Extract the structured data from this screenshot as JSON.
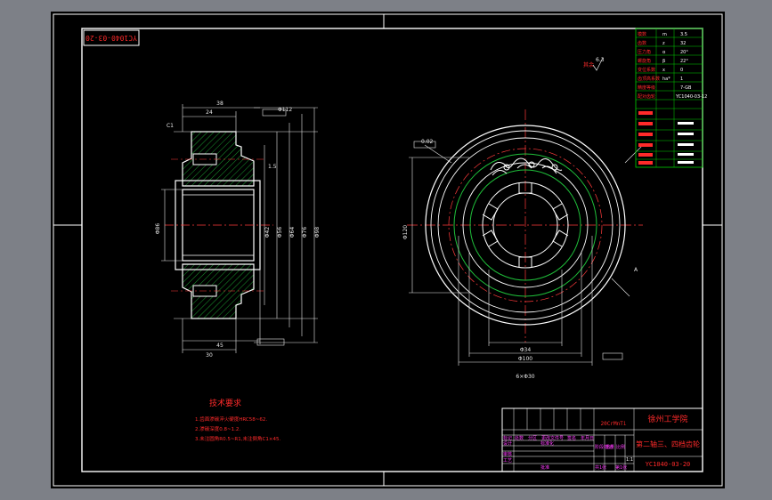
{
  "drawing": {
    "stamp_number": "YC1040-03-20",
    "school": "徐州工学院",
    "part_name": "第二轴三、四档齿轮",
    "material": "20CrMnTi",
    "drawing_number": "YC1040-03-20",
    "roughness_other": "其余",
    "roughness_other_value": "6.3"
  },
  "notes": {
    "title": "技术要求",
    "items": [
      "1.齿面渗碳淬火硬度HRC58~62.",
      "2.渗碳深度0.8~1.2.",
      "3.未注圆角R0.5~R1,未注倒角C1×45."
    ]
  },
  "param_table": {
    "rows": [
      [
        "模数",
        "m",
        "3.5"
      ],
      [
        "齿数",
        "z",
        "32"
      ],
      [
        "压力角",
        "α",
        "20°"
      ],
      [
        "螺旋角",
        "β",
        "22°"
      ],
      [
        "变位系数",
        "x",
        "0"
      ],
      [
        "齿顶高系数",
        "ha*",
        "1"
      ],
      [
        "精度等级",
        "",
        "7-GB"
      ],
      [
        "配对齿轮",
        "",
        "YC1040-03-12"
      ]
    ]
  },
  "title_block": {
    "labels": [
      "标记",
      "处数",
      "分区",
      "更改文件号",
      "签名",
      "年月日",
      "设计",
      "标准化",
      "审核",
      "工艺",
      "批准",
      "阶段标记",
      "重量",
      "比例",
      "共1张",
      "第1张"
    ],
    "scale": "1:1"
  },
  "dims": {
    "front": [
      "Φ86",
      "Φ42",
      "Φ56",
      "Φ64",
      "Φ76",
      "Φ98",
      "Φ112",
      "24",
      "30",
      "38",
      "45",
      "1.5",
      "C1"
    ],
    "side": [
      "Φ100",
      "Φ120",
      "Φ34",
      "6×Φ30",
      "0.02",
      "A"
    ]
  },
  "colors": {
    "paper": "#000000",
    "frame": "#ffffff",
    "outline": "#ffffff",
    "hatch": "#1fbf3a",
    "center": "#ff3b3b",
    "dim": "#e8e8e8",
    "table": "#00d000",
    "text_red": "#ff2a2a",
    "text_magenta": "#ff3dff",
    "text_yellow": "#ffff33"
  }
}
